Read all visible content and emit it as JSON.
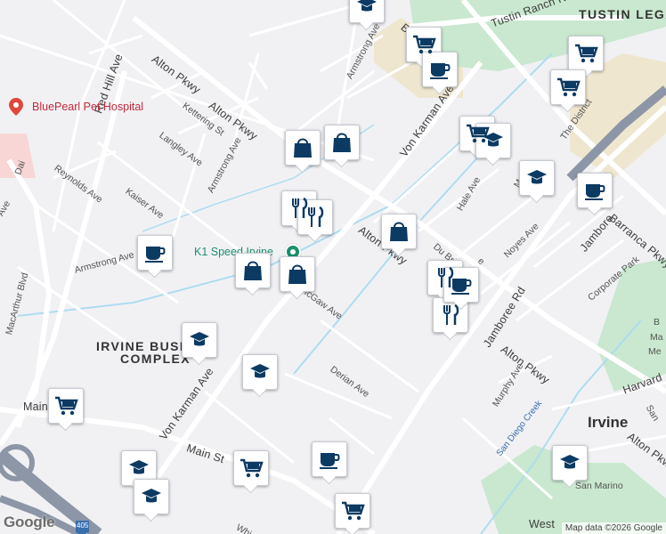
{
  "map": {
    "colors": {
      "land": "#f1f1f4",
      "road": "#ffffff",
      "highway": "#9aa3b2",
      "park": "#c9e8cf",
      "commercial": "#efe6cf",
      "water": "#aedcf0",
      "pin_icon": "#0b3a63"
    }
  },
  "labels": {
    "tustin_ranch_rd": "Tustin Ranch Rd",
    "tustin_legacy": "TUSTIN LEGAC",
    "alton_pkwy_nw1": "Alton Pkwy",
    "alton_pkwy_nw2": "Alton Pkwy",
    "alton_pkwy_mid": "Alton Pkwy",
    "alton_pkwy_se": "Alton Pkwy",
    "alton_pkwy_far": "Alton Pkwy",
    "red_hill_ave": "Red Hill Ave",
    "armstrong_ave_n": "Armstrong Ave",
    "armstrong_ave_mid": "Armstrong Ave",
    "armstrong_ave_s": "Armstrong Ave",
    "kettering_st": "Kettering St",
    "langley_ave": "Langley Ave",
    "reynolds_ave": "Reynolds Ave",
    "kaiser_ave": "Kaiser Ave",
    "dai_ave": "Dai",
    "ave_left": "Ave",
    "von_karman_ave_n": "Von Karman Ave",
    "von_karman_ave_s": "Von Karman Ave",
    "barranca_n": "Ba",
    "barranca_pkwy": "Barranca Pkwy",
    "jamboree": "Jambore",
    "jamboree_rd": "Jamboree Rd",
    "the_district": "The District",
    "hale_ave": "Hale Ave",
    "noyes_ave": "Noyes Ave",
    "m_ave": "M",
    "du_bridge": "Du Bri",
    "du_bridge_end": "e",
    "corporate_park": "Corporate Park",
    "mccaw_ave": "McGaw Ave",
    "derian_ave": "Derian Ave",
    "murphy_ave": "Murphy Ave",
    "macarthur_blvd": "MacArthur Blvd",
    "main_st_w": "Main",
    "main_st": "Main St",
    "whi": "Whi",
    "harvard": "Harvard",
    "san": "San",
    "san_marino": "San Marino",
    "west": "West",
    "irvine_business_complex_1": "IRVINE BUSIN",
    "irvine_business_complex_2": "COMPLEX",
    "irvine": "Irvine",
    "san_diego_creek": "San Diego Creek",
    "k1_speed": "K1 Speed Irvine",
    "bluepearl": "BluePearl Pet Hospital",
    "park_b": "B",
    "park_ma": "Ma",
    "park_me": "Me",
    "highway_405": "405"
  },
  "pins": [
    {
      "icon": "school"
    },
    {
      "icon": "grocery"
    },
    {
      "icon": "cafe"
    },
    {
      "icon": "grocery"
    },
    {
      "icon": "grocery"
    },
    {
      "icon": "grocery"
    },
    {
      "icon": "school"
    },
    {
      "icon": "shopping"
    },
    {
      "icon": "shopping"
    },
    {
      "icon": "school"
    },
    {
      "icon": "cafe"
    },
    {
      "icon": "restaurant"
    },
    {
      "icon": "restaurant"
    },
    {
      "icon": "shopping"
    },
    {
      "icon": "cafe"
    },
    {
      "icon": "shopping"
    },
    {
      "icon": "shopping"
    },
    {
      "icon": "restaurant"
    },
    {
      "icon": "restaurant"
    },
    {
      "icon": "cafe"
    },
    {
      "icon": "school"
    },
    {
      "icon": "school"
    },
    {
      "icon": "grocery"
    },
    {
      "icon": "cafe"
    },
    {
      "icon": "grocery"
    },
    {
      "icon": "school"
    },
    {
      "icon": "school"
    },
    {
      "icon": "grocery"
    },
    {
      "icon": "school"
    }
  ],
  "footer": {
    "logo": "Google",
    "attribution": "Map data ©2026 Google"
  }
}
